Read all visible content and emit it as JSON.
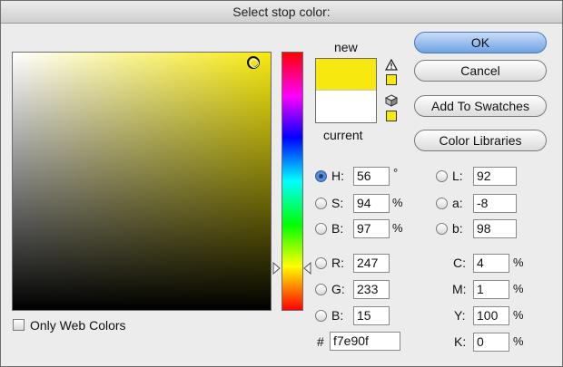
{
  "window": {
    "title": "Select stop color:"
  },
  "preview": {
    "new_label": "new",
    "current_label": "current"
  },
  "buttons": {
    "ok": "OK",
    "cancel": "Cancel",
    "add_to_swatches": "Add To Swatches",
    "color_libraries": "Color Libraries"
  },
  "hsb": {
    "h": {
      "label": "H:",
      "value": "56",
      "unit": "°"
    },
    "s": {
      "label": "S:",
      "value": "94",
      "unit": "%"
    },
    "b": {
      "label": "B:",
      "value": "97",
      "unit": "%"
    }
  },
  "rgb": {
    "r": {
      "label": "R:",
      "value": "247"
    },
    "g": {
      "label": "G:",
      "value": "233"
    },
    "b": {
      "label": "B:",
      "value": "15"
    }
  },
  "lab": {
    "l": {
      "label": "L:",
      "value": "92"
    },
    "a": {
      "label": "a:",
      "value": "-8"
    },
    "b": {
      "label": "b:",
      "value": "98"
    }
  },
  "cmyk": {
    "c": {
      "label": "C:",
      "value": "4",
      "unit": "%"
    },
    "m": {
      "label": "M:",
      "value": "1",
      "unit": "%"
    },
    "y": {
      "label": "Y:",
      "value": "100",
      "unit": "%"
    },
    "k": {
      "label": "K:",
      "value": "0",
      "unit": "%"
    }
  },
  "hex": {
    "label": "#",
    "value": "f7e90f"
  },
  "only_web_colors": {
    "label": "Only Web Colors",
    "checked": false
  },
  "colors": {
    "new": "#f7e90f",
    "current": "#ffffff",
    "accent": "#6fa2e3"
  },
  "icons": {
    "gamut_warning": "warning-triangle-icon",
    "web_safe": "cube-icon"
  }
}
